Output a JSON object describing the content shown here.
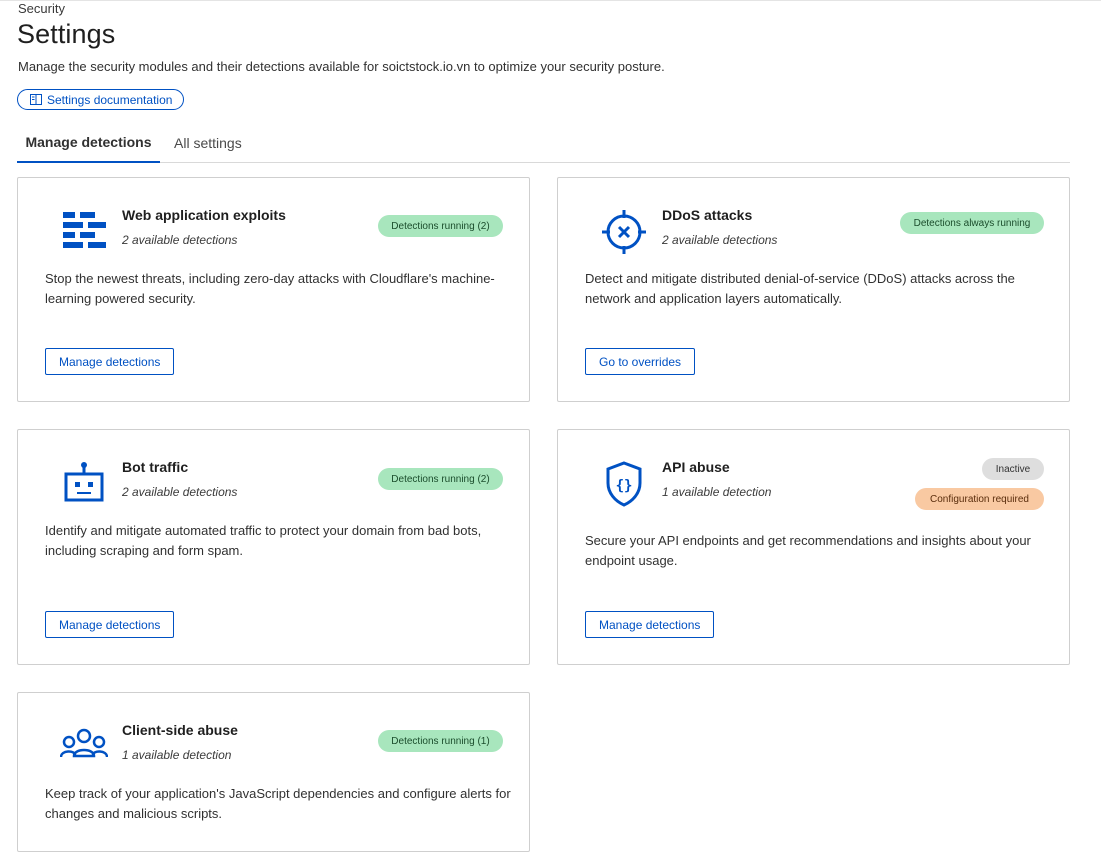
{
  "breadcrumb": "Security",
  "page": {
    "title": "Settings",
    "description": "Manage the security modules and their detections available for soictstock.io.vn to optimize your security posture.",
    "doc_button": "Settings documentation"
  },
  "tabs": [
    {
      "label": "Manage detections",
      "active": true
    },
    {
      "label": "All settings",
      "active": false
    }
  ],
  "colors": {
    "accent": "#0051c3",
    "running": "#a8e6bd",
    "inactive": "#dedede",
    "config_required": "#f9c9a2"
  },
  "cards": [
    {
      "icon": "firewall-icon",
      "title": "Web application exploits",
      "subtitle": "2 available detections",
      "description": "Stop the newest threats, including zero-day attacks with Cloudflare's machine-learning powered security.",
      "badges": [
        "Detections running (2)"
      ],
      "action": "Manage detections"
    },
    {
      "icon": "ddos-target-icon",
      "title": "DDoS attacks",
      "subtitle": "2 available detections",
      "description": "Detect and mitigate distributed denial-of-service (DDoS) attacks across the network and application layers automatically.",
      "badges": [
        "Detections always running"
      ],
      "action": "Go to overrides"
    },
    {
      "icon": "robot-icon",
      "title": "Bot traffic",
      "subtitle": "2 available detections",
      "description": "Identify and mitigate automated traffic to protect your domain from bad bots, including scraping and form spam.",
      "badges": [
        "Detections running (2)"
      ],
      "action": "Manage detections"
    },
    {
      "icon": "api-shield-icon",
      "title": "API abuse",
      "subtitle": "1 available detection",
      "description": "Secure your API endpoints and get recommendations and insights about your endpoint usage.",
      "badges": [
        "Inactive",
        "Configuration required"
      ],
      "action": "Manage detections"
    },
    {
      "icon": "users-group-icon",
      "title": "Client-side abuse",
      "subtitle": "1 available detection",
      "description": "Keep track of your application's JavaScript dependencies and configure alerts for changes and malicious scripts.",
      "badges": [
        "Detections running (1)"
      ],
      "action": ""
    }
  ]
}
